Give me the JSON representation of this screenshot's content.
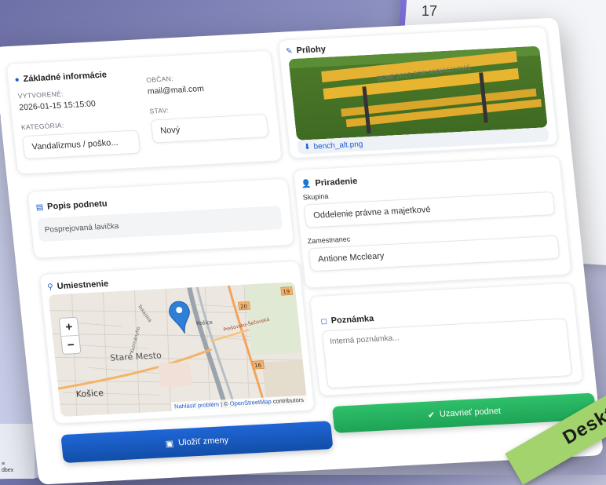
{
  "background": {
    "number": "17",
    "side_list": "≡\ndbex"
  },
  "info": {
    "title": "Základné informácie",
    "created_label": "VYTVORENÉ:",
    "created_value": "2026-01-15 15:15:00",
    "citizen_label": "OBČAN:",
    "citizen_value": "mail@mail.com",
    "category_label": "KATEGÓRIA:",
    "category_value": "Vandalizmus / poško...",
    "status_label": "STAV:",
    "status_value": "Nový"
  },
  "attachments": {
    "title": "Prílohy",
    "file_name": "bench_alt.png",
    "graffiti_text": "BENE 2017 FOR ANNA&LUKAS"
  },
  "description": {
    "title": "Popis podnetu",
    "text": "Posprejovaná lavička"
  },
  "assignment": {
    "title": "Priradenie",
    "group_label": "Skupina",
    "group_value": "Oddelenie právne a majetkové",
    "employee_label": "Zamestnanec",
    "employee_value": "Antione Mccleary"
  },
  "location": {
    "title": "Umiestnenie",
    "zoom_in": "+",
    "zoom_out": "−",
    "city_labels": [
      "Staré Mesto",
      "Košice",
      "Košice",
      "Tokajská",
      "Prešovsko-Šečovská",
      "Kuzmányho"
    ],
    "road_numbers": [
      "20",
      "19",
      "16"
    ],
    "attribution_link1": "Nahlásiť problém",
    "attribution_sep": " | © ",
    "attribution_link2": "OpenStreetMap",
    "attribution_tail": " contributors"
  },
  "note": {
    "title": "Poznámka",
    "placeholder": "Interná poznámka..."
  },
  "buttons": {
    "save": "Uložiť zmeny",
    "close": "Uzavrieť podnet"
  },
  "badge": "Deskt",
  "colors": {
    "primary": "#1f5bd1",
    "success": "#22b45e",
    "badge": "#a3d36d"
  }
}
